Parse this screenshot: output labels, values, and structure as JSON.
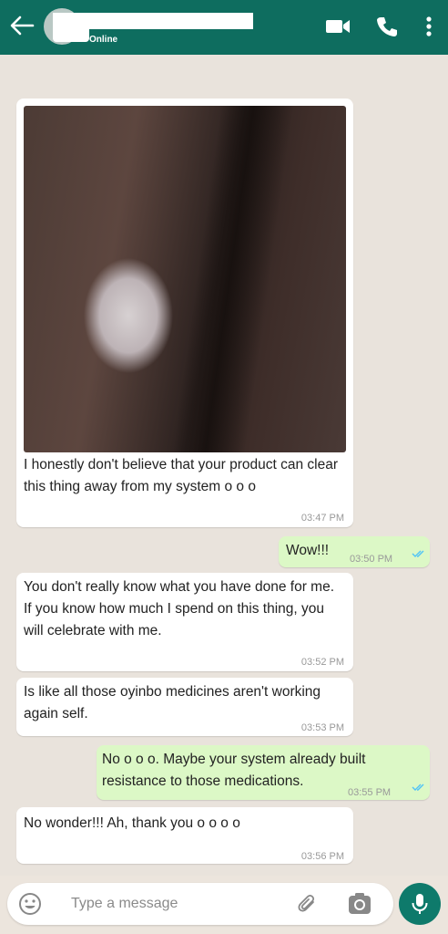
{
  "header": {
    "status": "Online"
  },
  "messages": [
    {
      "text": "I honestly don't believe that your product can clear this thing away from my system o o o",
      "time": "03:47 PM"
    },
    {
      "text": "Wow!!!",
      "time": "03:50 PM"
    },
    {
      "text": "You don't really know what you have done for me. If you know how much I spend on this thing, you will celebrate with me.",
      "time": "03:52 PM"
    },
    {
      "text": "Is like all those oyinbo medicines aren't working again self.",
      "time": "03:53 PM"
    },
    {
      "text": "No o o o. Maybe your system already built resistance to those medications.",
      "time": "03:55 PM"
    },
    {
      "text": "No wonder!!! Ah, thank you o o o o",
      "time": "03:56 PM"
    }
  ],
  "composer": {
    "placeholder": "Type a message"
  },
  "icons": {
    "back": "arrow-left-icon",
    "video": "video-camera-icon",
    "call": "phone-icon",
    "menu": "more-vertical-icon",
    "emoji": "emoji-icon",
    "attach": "paperclip-icon",
    "camera": "camera-icon",
    "mic": "microphone-icon"
  },
  "colors": {
    "header": "#0E6D5F",
    "background": "#ECE5DD",
    "outgoing": "#DCF8C6",
    "incoming": "#FFFFFF",
    "read_ticks": "#4FC3F7"
  }
}
